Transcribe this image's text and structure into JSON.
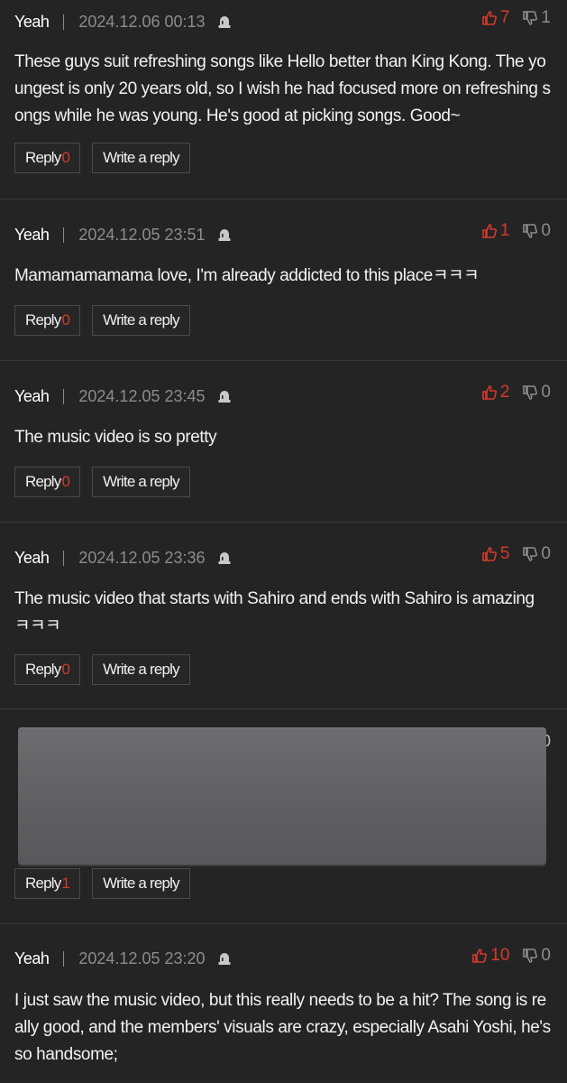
{
  "comments": [
    {
      "author": "Yeah",
      "date": "2024.12.06 00:13",
      "likes": "7",
      "dislikes": "1",
      "text": "These guys suit refreshing songs like Hello better than King Kong. The youngest is only 20 years old, so I wish he had focused more on refreshing songs while he was young. He's good at picking songs. Good~",
      "reply_label": "Reply",
      "reply_count": "0",
      "write_label": "Write a reply"
    },
    {
      "author": "Yeah",
      "date": "2024.12.05 23:51",
      "likes": "1",
      "dislikes": "0",
      "text": "Mamamamamama love, I'm already addicted to this placeㅋㅋㅋ",
      "reply_label": "Reply",
      "reply_count": "0",
      "write_label": "Write a reply"
    },
    {
      "author": "Yeah",
      "date": "2024.12.05 23:45",
      "likes": "2",
      "dislikes": "0",
      "text": "The music video is so pretty",
      "reply_label": "Reply",
      "reply_count": "0",
      "write_label": "Write a reply"
    },
    {
      "author": "Yeah",
      "date": "2024.12.05 23:36",
      "likes": "5",
      "dislikes": "0",
      "text": "The music video that starts with Sahiro and ends with Sahiro is amazing ㅋㅋㅋ",
      "reply_label": "Reply",
      "reply_count": "0",
      "write_label": "Write a reply"
    },
    {
      "reply_label": "Reply",
      "reply_count": "1",
      "write_label": "Write a reply",
      "dislikes_partial": "0"
    },
    {
      "author": "Yeah",
      "date": "2024.12.05 23:20",
      "likes": "10",
      "dislikes": "0",
      "text": "I just saw the music video, but this really needs to be a hit? The song is really good, and the members' visuals are crazy, especially Asahi Yoshi, he's so handsome;"
    }
  ],
  "colors": {
    "background": "#242424",
    "like": "#d6392c",
    "muted": "#8c8c8c",
    "redaction": "#636366"
  },
  "icons": {
    "like": "thumbs-up-icon",
    "dislike": "thumbs-down-icon",
    "report": "siren-icon"
  }
}
